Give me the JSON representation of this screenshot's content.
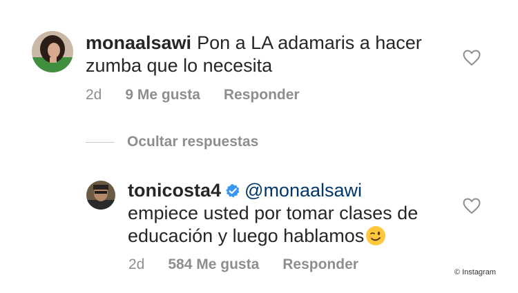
{
  "comment": {
    "username": "monaalsawi",
    "text_line1": "Pon a LA adamaris a hacer",
    "text_line2": "zumba que lo necesita",
    "time": "2d",
    "likes": "9 Me gusta",
    "reply_label": "Responder",
    "icon": "heart-outline-icon"
  },
  "replies_toggle": "Ocultar respuestas",
  "reply": {
    "username": "tonicosta4",
    "verified_icon": "verified-badge-icon",
    "mention": "@monaalsawi",
    "text_line1": "empiece usted por tomar clases de",
    "text_line2": "educación y luego hablamos",
    "emoji": "winking-face-emoji",
    "time": "2d",
    "likes": "584 Me gusta",
    "reply_label": "Responder",
    "icon": "heart-outline-icon"
  },
  "watermark": "© Instagram",
  "colors": {
    "text": "#262626",
    "meta": "#8e8e8e",
    "mention": "#00376b",
    "verified": "#3897f0"
  }
}
